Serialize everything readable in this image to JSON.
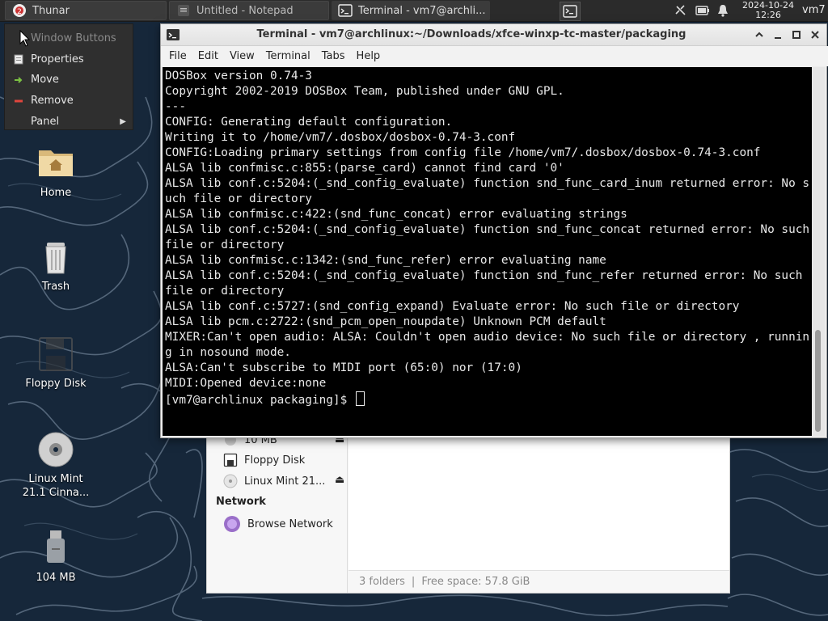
{
  "taskbar": {
    "tasks": [
      {
        "label": "Thunar"
      },
      {
        "label": "Untitled - Notepad"
      },
      {
        "label": "Terminal - vm7@archli..."
      }
    ],
    "clock_date": "2024-10-24",
    "clock_time": "12:26",
    "user": "vm7"
  },
  "context_menu": {
    "items": [
      {
        "label": "Window Buttons",
        "disabled": true
      },
      {
        "label": "Properties"
      },
      {
        "label": "Move"
      },
      {
        "label": "Remove"
      },
      {
        "label": "Panel"
      }
    ]
  },
  "desktop_icons": [
    {
      "label": "Home"
    },
    {
      "label": "Trash"
    },
    {
      "label": "Floppy Disk"
    },
    {
      "label": "Linux Mint 21.1 Cinna..."
    },
    {
      "label": "104 MB"
    }
  ],
  "thunar": {
    "sidebar": {
      "items": [
        {
          "label": "10 MB"
        },
        {
          "label": "Floppy Disk"
        },
        {
          "label": "Linux Mint 21..."
        }
      ],
      "network_header": "Network",
      "network_items": [
        {
          "label": "Browse Network"
        }
      ]
    },
    "status": {
      "folders": "3 folders",
      "separator": "|",
      "free_space": "Free space: 57.8 GiB"
    }
  },
  "terminal": {
    "title": "Terminal - vm7@archlinux:~/Downloads/xfce-winxp-tc-master/packaging",
    "menu": [
      "File",
      "Edit",
      "View",
      "Terminal",
      "Tabs",
      "Help"
    ],
    "output": "DOSBox version 0.74-3\nCopyright 2002-2019 DOSBox Team, published under GNU GPL.\n---\nCONFIG: Generating default configuration.\nWriting it to /home/vm7/.dosbox/dosbox-0.74-3.conf\nCONFIG:Loading primary settings from config file /home/vm7/.dosbox/dosbox-0.74-3.conf\nALSA lib confmisc.c:855:(parse_card) cannot find card '0'\nALSA lib conf.c:5204:(_snd_config_evaluate) function snd_func_card_inum returned error: No such file or directory\nALSA lib confmisc.c:422:(snd_func_concat) error evaluating strings\nALSA lib conf.c:5204:(_snd_config_evaluate) function snd_func_concat returned error: No such file or directory\nALSA lib confmisc.c:1342:(snd_func_refer) error evaluating name\nALSA lib conf.c:5204:(_snd_config_evaluate) function snd_func_refer returned error: No such file or directory\nALSA lib conf.c:5727:(snd_config_expand) Evaluate error: No such file or directory\nALSA lib pcm.c:2722:(snd_pcm_open_noupdate) Unknown PCM default\nMIXER:Can't open audio: ALSA: Couldn't open audio device: No such file or directory , running in nosound mode.\nALSA:Can't subscribe to MIDI port (65:0) nor (17:0)\nMIDI:Opened device:none",
    "prompt": "[vm7@archlinux packaging]$ "
  },
  "colors": {
    "panel_bg": "#2b2b2b",
    "desktop_bg": "#16273a",
    "terminal_bg": "#000000",
    "terminal_fg": "#e8e8e8"
  }
}
